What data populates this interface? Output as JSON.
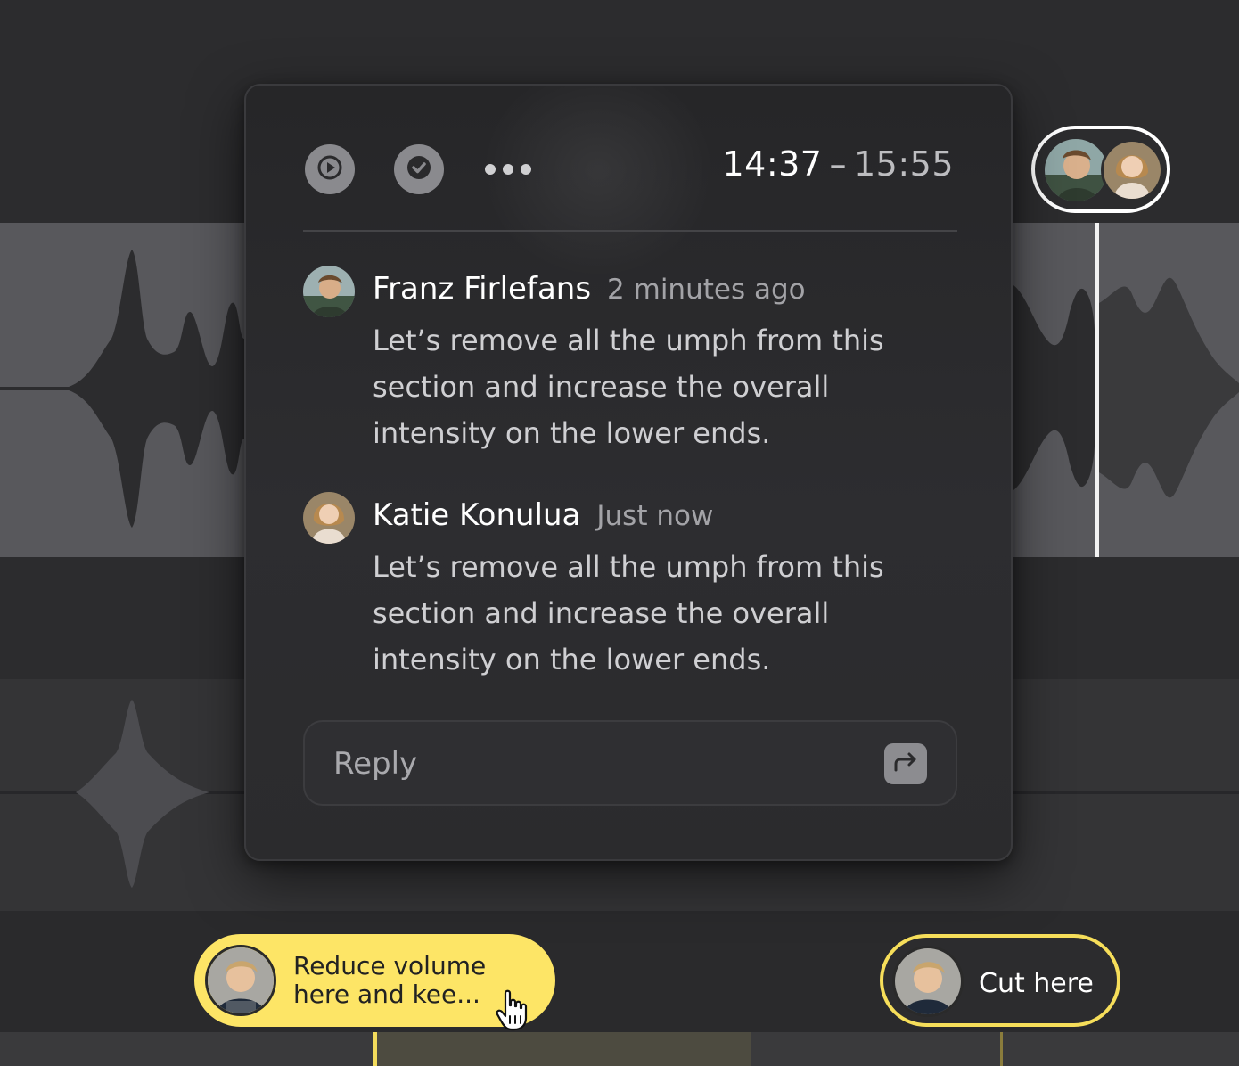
{
  "toolbar": {
    "play_icon": "play-icon",
    "resolve_icon": "check-icon",
    "more_icon": "more-dots-icon"
  },
  "time_range": {
    "start": "14:37",
    "separator": "–",
    "end": "15:55"
  },
  "comments": [
    {
      "author": "Franz Firlefans",
      "time": "2 minutes ago",
      "body": "Let’s remove all the umph from this section and increase the overall intensity on the lower ends."
    },
    {
      "author": "Katie Konulua",
      "time": "Just now",
      "body": "Let’s remove all the umph from this section and increase the overall intensity on the lower ends."
    }
  ],
  "reply": {
    "placeholder": "Reply",
    "send_icon": "reply-arrow-icon"
  },
  "timeline_notes": [
    {
      "text": "Reduce volume\nhere and kee...",
      "color": "#fde566"
    },
    {
      "text": "Cut here",
      "color": "#f6de5a"
    }
  ],
  "colors": {
    "accent_yellow": "#fde566",
    "background": "#2c2c2e",
    "panel": "#2a2a2c",
    "waveform": "#2c2c2e"
  }
}
